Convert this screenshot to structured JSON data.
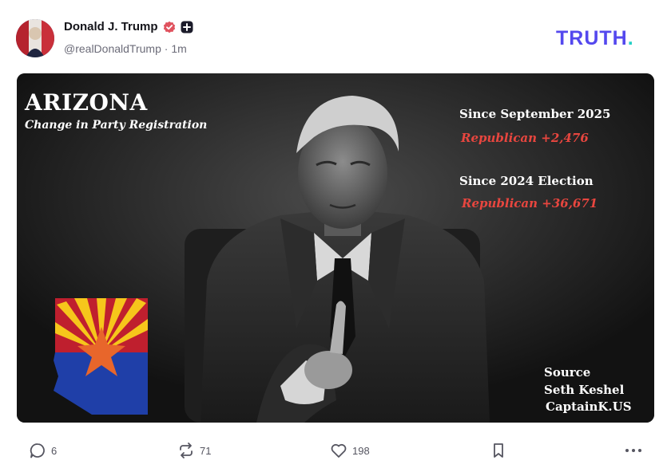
{
  "post": {
    "author_name": "Donald J. Trump",
    "handle": "@realDonaldTrump",
    "separator": "·",
    "time_ago": "1m"
  },
  "brand": {
    "logo_text": "TRUTH.",
    "logo_color": "#5448ee",
    "accent_color": "#25d0c6"
  },
  "image": {
    "title": "ARIZONA",
    "subtitle": "Change in Party Registration",
    "stat1_label": "Since September 2025",
    "stat1_value": "Republican +2,476",
    "stat2_label": "Since 2024 Election",
    "stat2_value": "Republican +36,671",
    "source_label": "Source",
    "source_name": "Seth Keshel",
    "source_site": "CaptainK.US",
    "highlight_color": "#e8463f"
  },
  "actions": {
    "replies": "6",
    "retruths": "71",
    "likes": "198"
  },
  "icons": {
    "reply": "comment-icon",
    "retruth": "retruth-icon",
    "like": "heart-icon",
    "bookmark": "bookmark-icon",
    "more": "ellipsis-icon",
    "verified": "verified-badge-icon",
    "plus": "plus-badge-icon"
  }
}
